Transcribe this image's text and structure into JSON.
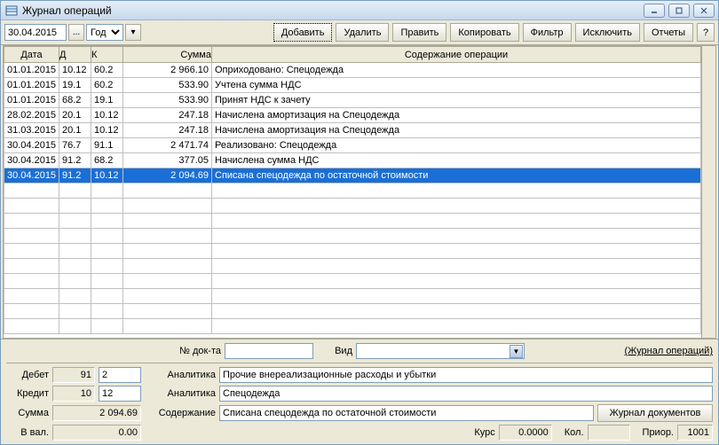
{
  "window": {
    "title": "Журнал операций"
  },
  "toolbar": {
    "date_value": "30.04.2015",
    "period_value": "Год",
    "buttons": {
      "add": "Добавить",
      "delete": "Удалить",
      "edit": "Править",
      "copy": "Копировать",
      "filter": "Фильтр",
      "exclude": "Исключить",
      "reports": "Отчеты",
      "help": "?"
    }
  },
  "grid": {
    "headers": {
      "date": "Дата",
      "debit": "Д",
      "credit": "К",
      "sum": "Сумма",
      "desc": "Содержание операции"
    },
    "rows": [
      {
        "date": "01.01.2015",
        "d": "10.12",
        "k": "60.2",
        "sum": "2 966.10",
        "desc": "Оприходовано: Спецодежда"
      },
      {
        "date": "01.01.2015",
        "d": "19.1",
        "k": "60.2",
        "sum": "533.90",
        "desc": "Учтена сумма НДС"
      },
      {
        "date": "01.01.2015",
        "d": "68.2",
        "k": "19.1",
        "sum": "533.90",
        "desc": "Принят НДС к зачету"
      },
      {
        "date": "28.02.2015",
        "d": "20.1",
        "k": "10.12",
        "sum": "247.18",
        "desc": "Начислена амортизация на Спецодежда"
      },
      {
        "date": "31.03.2015",
        "d": "20.1",
        "k": "10.12",
        "sum": "247.18",
        "desc": "Начислена амортизация на Спецодежда"
      },
      {
        "date": "30.04.2015",
        "d": "76.7",
        "k": "91.1",
        "sum": "2 471.74",
        "desc": "Реализовано: Спецодежда"
      },
      {
        "date": "30.04.2015",
        "d": "91.2",
        "k": "68.2",
        "sum": "377.05",
        "desc": "Начислена сумма НДС"
      },
      {
        "date": "30.04.2015",
        "d": "91.2",
        "k": "10.12",
        "sum": "2 094.69",
        "desc": "Списана спецодежда по остаточной стоимости",
        "selected": true
      }
    ]
  },
  "detail": {
    "labels": {
      "doc_no": "№ док-та",
      "kind": "Вид",
      "journal_link": "(Журнал операций)",
      "debit": "Дебет",
      "credit": "Кредит",
      "sum": "Сумма",
      "in_currency": "В вал.",
      "analytics": "Аналитика",
      "content": "Содержание",
      "journal_docs_btn": "Журнал документов",
      "rate": "Курс",
      "qty": "Кол.",
      "prior": "Приор."
    },
    "values": {
      "doc_no": "",
      "kind": "",
      "debit_acc": "91",
      "debit_sub": "2",
      "credit_acc": "10",
      "credit_sub": "12",
      "sum": "2 094.69",
      "in_currency": "0.00",
      "analytics1": "Прочие внереализационные расходы и убытки",
      "analytics2": "Спецодежда",
      "content": "Списана спецодежда по остаточной стоимости",
      "rate": "0.0000",
      "qty": "",
      "prior": "1001"
    }
  }
}
